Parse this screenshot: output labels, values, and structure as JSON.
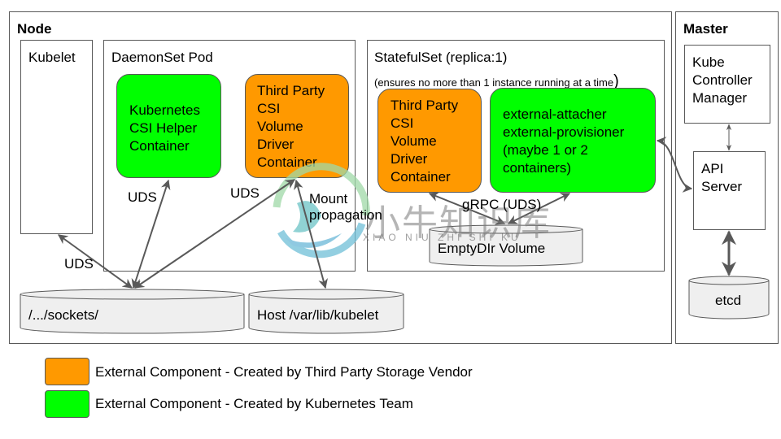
{
  "node": {
    "title": "Node",
    "kubelet": {
      "label": "Kubelet"
    },
    "daemonset": {
      "title": "DaemonSet Pod",
      "helper": {
        "label": "Kubernetes\nCSI Helper\nContainer"
      },
      "driver": {
        "label": "Third Party\nCSI\nVolume\nDriver\nContainer"
      }
    },
    "statefulset": {
      "title": "StatefulSet (replica:1)",
      "subtitle": "(ensures no more than 1 instance running at a time",
      "subtitle_close": ")",
      "driver": {
        "label": "Third Party\nCSI\nVolume\nDriver\nContainer"
      },
      "sidecars": {
        "label": "external-attacher\nexternal-provisioner\n(maybe 1 or 2\ncontainers)"
      },
      "emptydir": {
        "label": "EmptyDIr Volume"
      }
    },
    "sockets": {
      "label": "/.../sockets/"
    },
    "host_kubelet": {
      "label": "Host /var/lib/kubelet"
    }
  },
  "master": {
    "title": "Master",
    "controller_manager": {
      "label": "Kube\nController\nManager"
    },
    "api_server": {
      "label": "API\nServer"
    },
    "etcd": {
      "label": "etcd"
    }
  },
  "connections": {
    "uds_kubelet": "UDS",
    "uds_helper": "UDS",
    "uds_driver": "UDS",
    "mount_propagation": "Mount\npropagation",
    "grpc": "gRPC (UDS)"
  },
  "legend": [
    {
      "label": "External Component - Created by Third Party Storage Vendor",
      "color": "#ff9900"
    },
    {
      "label": "External Component - Created by Kubernetes Team",
      "color": "#00ff00"
    }
  ],
  "watermark": {
    "chinese": "小牛知识库",
    "pinyin": "XIAO NIU ZHI SHI KU"
  },
  "colors": {
    "external_vendor": "#ff9900",
    "kubernetes_team": "#00ff00",
    "stroke": "#595959",
    "cylinder_fill": "#efefef"
  }
}
